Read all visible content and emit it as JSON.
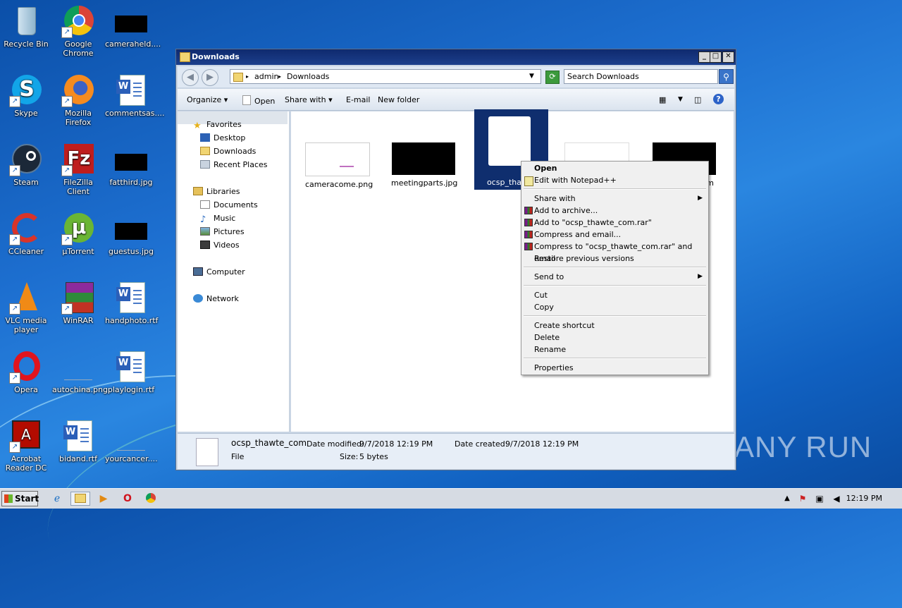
{
  "desktop": {
    "icons": [
      {
        "label": "Recycle Bin"
      },
      {
        "label": "Google Chrome"
      },
      {
        "label": "cameraheld...."
      },
      {
        "label": "Skype"
      },
      {
        "label": "Mozilla Firefox"
      },
      {
        "label": "commentsas...."
      },
      {
        "label": "Steam"
      },
      {
        "label": "FileZilla Client"
      },
      {
        "label": "fatthird.jpg"
      },
      {
        "label": "CCleaner"
      },
      {
        "label": "µTorrent"
      },
      {
        "label": "guestus.jpg"
      },
      {
        "label": "VLC media player"
      },
      {
        "label": "WinRAR"
      },
      {
        "label": "handphoto.rtf"
      },
      {
        "label": "Opera"
      },
      {
        "label": "autochina.png"
      },
      {
        "label": "playlogin.rtf"
      },
      {
        "label": "Acrobat Reader DC"
      },
      {
        "label": "bidand.rtf"
      },
      {
        "label": "yourcancer...."
      }
    ],
    "watermark": "ANY RUN"
  },
  "window": {
    "title": "Downloads",
    "address": {
      "crumbs": [
        "admin",
        "Downloads"
      ]
    },
    "search_placeholder": "Search Downloads",
    "toolbar": {
      "organize": "Organize",
      "open": "Open",
      "share_with": "Share with",
      "email": "E-mail",
      "new_folder": "New folder"
    },
    "nav": {
      "favorites": "Favorites",
      "desktop": "Desktop",
      "downloads": "Downloads",
      "recent_places": "Recent Places",
      "libraries": "Libraries",
      "documents": "Documents",
      "music": "Music",
      "pictures": "Pictures",
      "videos": "Videos",
      "computer": "Computer",
      "network": "Network"
    },
    "files": [
      {
        "name": "cameracome.png"
      },
      {
        "name": "meetingparts.jpg"
      },
      {
        "name": "ocsp_thawte"
      },
      {
        "name": ""
      },
      {
        "name": "em"
      }
    ],
    "details": {
      "name": "ocsp_thawte_com",
      "type": "File",
      "modified_label": "Date modified:",
      "modified": "9/7/2018 12:19 PM",
      "created_label": "Date created:",
      "created": "9/7/2018 12:19 PM",
      "size_label": "Size:",
      "size": "5 bytes"
    }
  },
  "context_menu": {
    "open": "Open",
    "edit_notepad": "Edit with Notepad++",
    "share_with": "Share with",
    "add_archive": "Add to archive...",
    "add_rar": "Add to \"ocsp_thawte_com.rar\"",
    "compress_email": "Compress and email...",
    "compress_rar_email": "Compress to \"ocsp_thawte_com.rar\" and email",
    "restore": "Restore previous versions",
    "send_to": "Send to",
    "cut": "Cut",
    "copy": "Copy",
    "create_shortcut": "Create shortcut",
    "delete": "Delete",
    "rename": "Rename",
    "properties": "Properties"
  },
  "taskbar": {
    "start": "Start",
    "clock": "12:19 PM"
  }
}
